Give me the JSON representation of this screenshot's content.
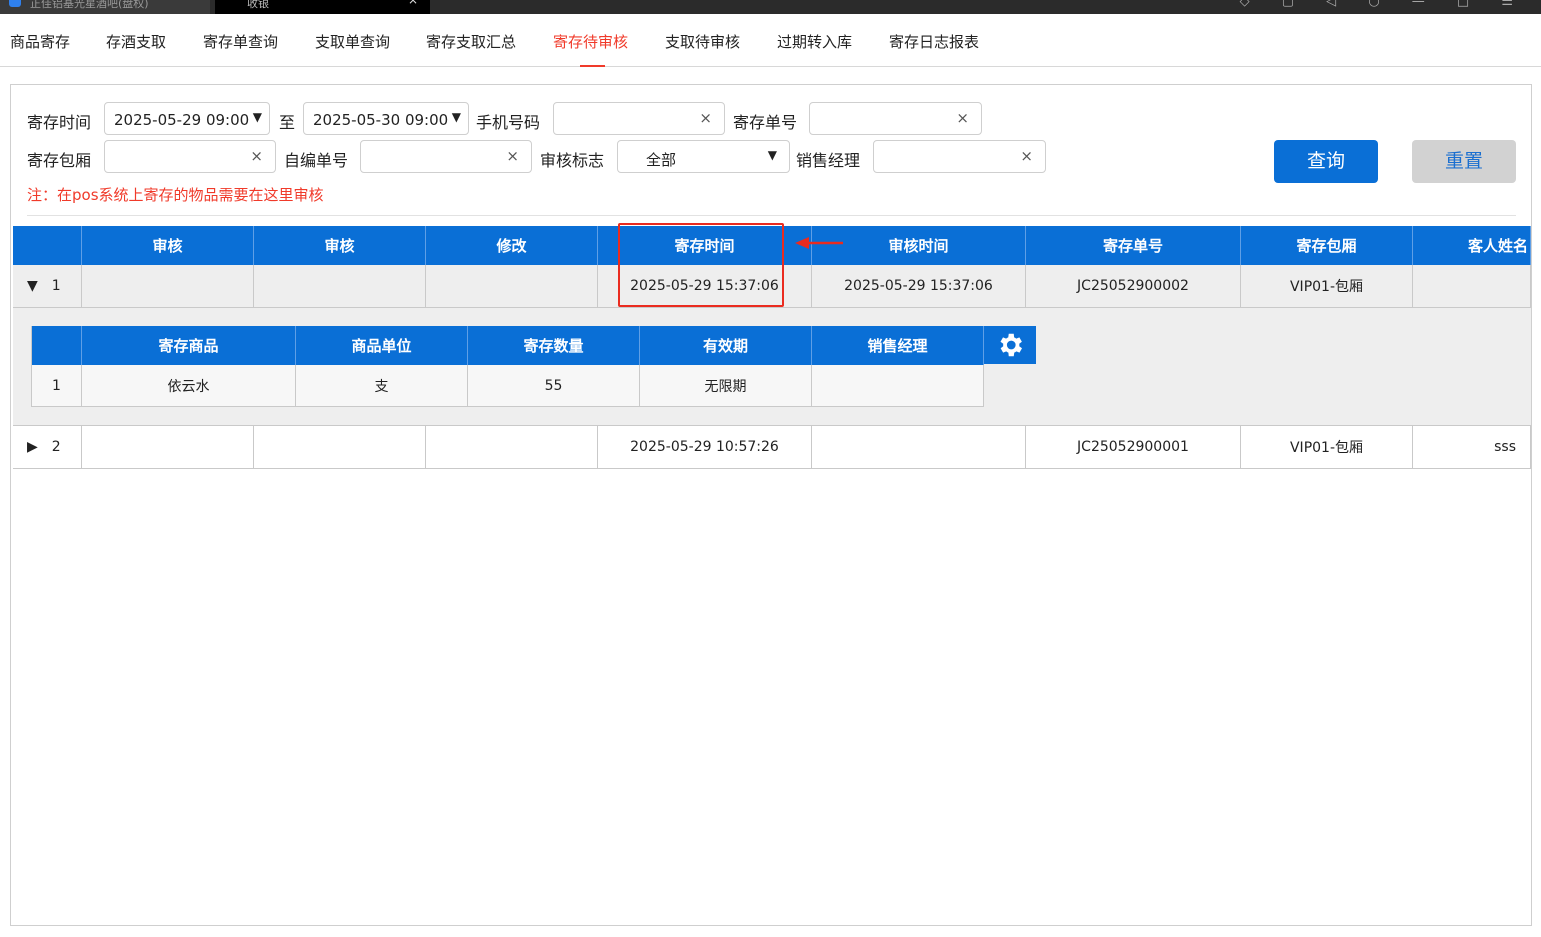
{
  "titlebar": {
    "tab1_label": "正佳铝基光星酒吧(盘权)",
    "tab2_label": "收银",
    "tab2_close": "×",
    "controls": "◇ ▢ ◁ ○ — □ ☰"
  },
  "nav": {
    "items": [
      "商品寄存",
      "存酒支取",
      "寄存单查询",
      "支取单查询",
      "寄存支取汇总",
      "寄存待审核",
      "支取待审核",
      "过期转入库",
      "寄存日志报表"
    ],
    "active_index": 5
  },
  "filters": {
    "deposit_time_label": "寄存时间",
    "start_time": "2025-05-29 09:00",
    "to_label": "至",
    "end_time": "2025-05-30 09:00",
    "phone_label": "手机号码",
    "phone_value": "",
    "deposit_no_label": "寄存单号",
    "deposit_no_value": "",
    "room_label": "寄存包厢",
    "room_value": "",
    "custom_no_label": "自编单号",
    "custom_no_value": "",
    "audit_flag_label": "审核标志",
    "audit_flag_value": "全部",
    "manager_label": "销售经理",
    "manager_value": "",
    "clear_glyph": "×",
    "caret_glyph": "▼"
  },
  "buttons": {
    "query": "查询",
    "reset": "重置"
  },
  "note": "注：在pos系统上寄存的物品需要在这里审核",
  "table": {
    "columns": [
      "",
      "审核",
      "审核",
      "修改",
      "寄存时间",
      "审核时间",
      "寄存单号",
      "寄存包厢",
      "客人姓名"
    ],
    "rows": [
      {
        "expander": "▼",
        "index": "1",
        "audit1": "",
        "audit2": "",
        "modify": "",
        "deposit_time": "2025-05-29 15:37:06",
        "audit_time": "2025-05-29 15:37:06",
        "deposit_no": "JC25052900002",
        "room": "VIP01-包厢",
        "guest": ""
      },
      {
        "expander": "▶",
        "index": "2",
        "audit1": "",
        "audit2": "",
        "modify": "",
        "deposit_time": "2025-05-29 10:57:26",
        "audit_time": "",
        "deposit_no": "JC25052900001",
        "room": "VIP01-包厢",
        "guest": "sss"
      }
    ]
  },
  "detail": {
    "columns": [
      "",
      "寄存商品",
      "商品单位",
      "寄存数量",
      "有效期",
      "销售经理"
    ],
    "rows": [
      {
        "index": "1",
        "product": "依云水",
        "unit": "支",
        "qty": "55",
        "validity": "无限期",
        "manager": ""
      }
    ]
  },
  "colors": {
    "accent": "#0a6fd6",
    "active_tab": "#f03a2a",
    "annotation": "#ea2b1f"
  }
}
